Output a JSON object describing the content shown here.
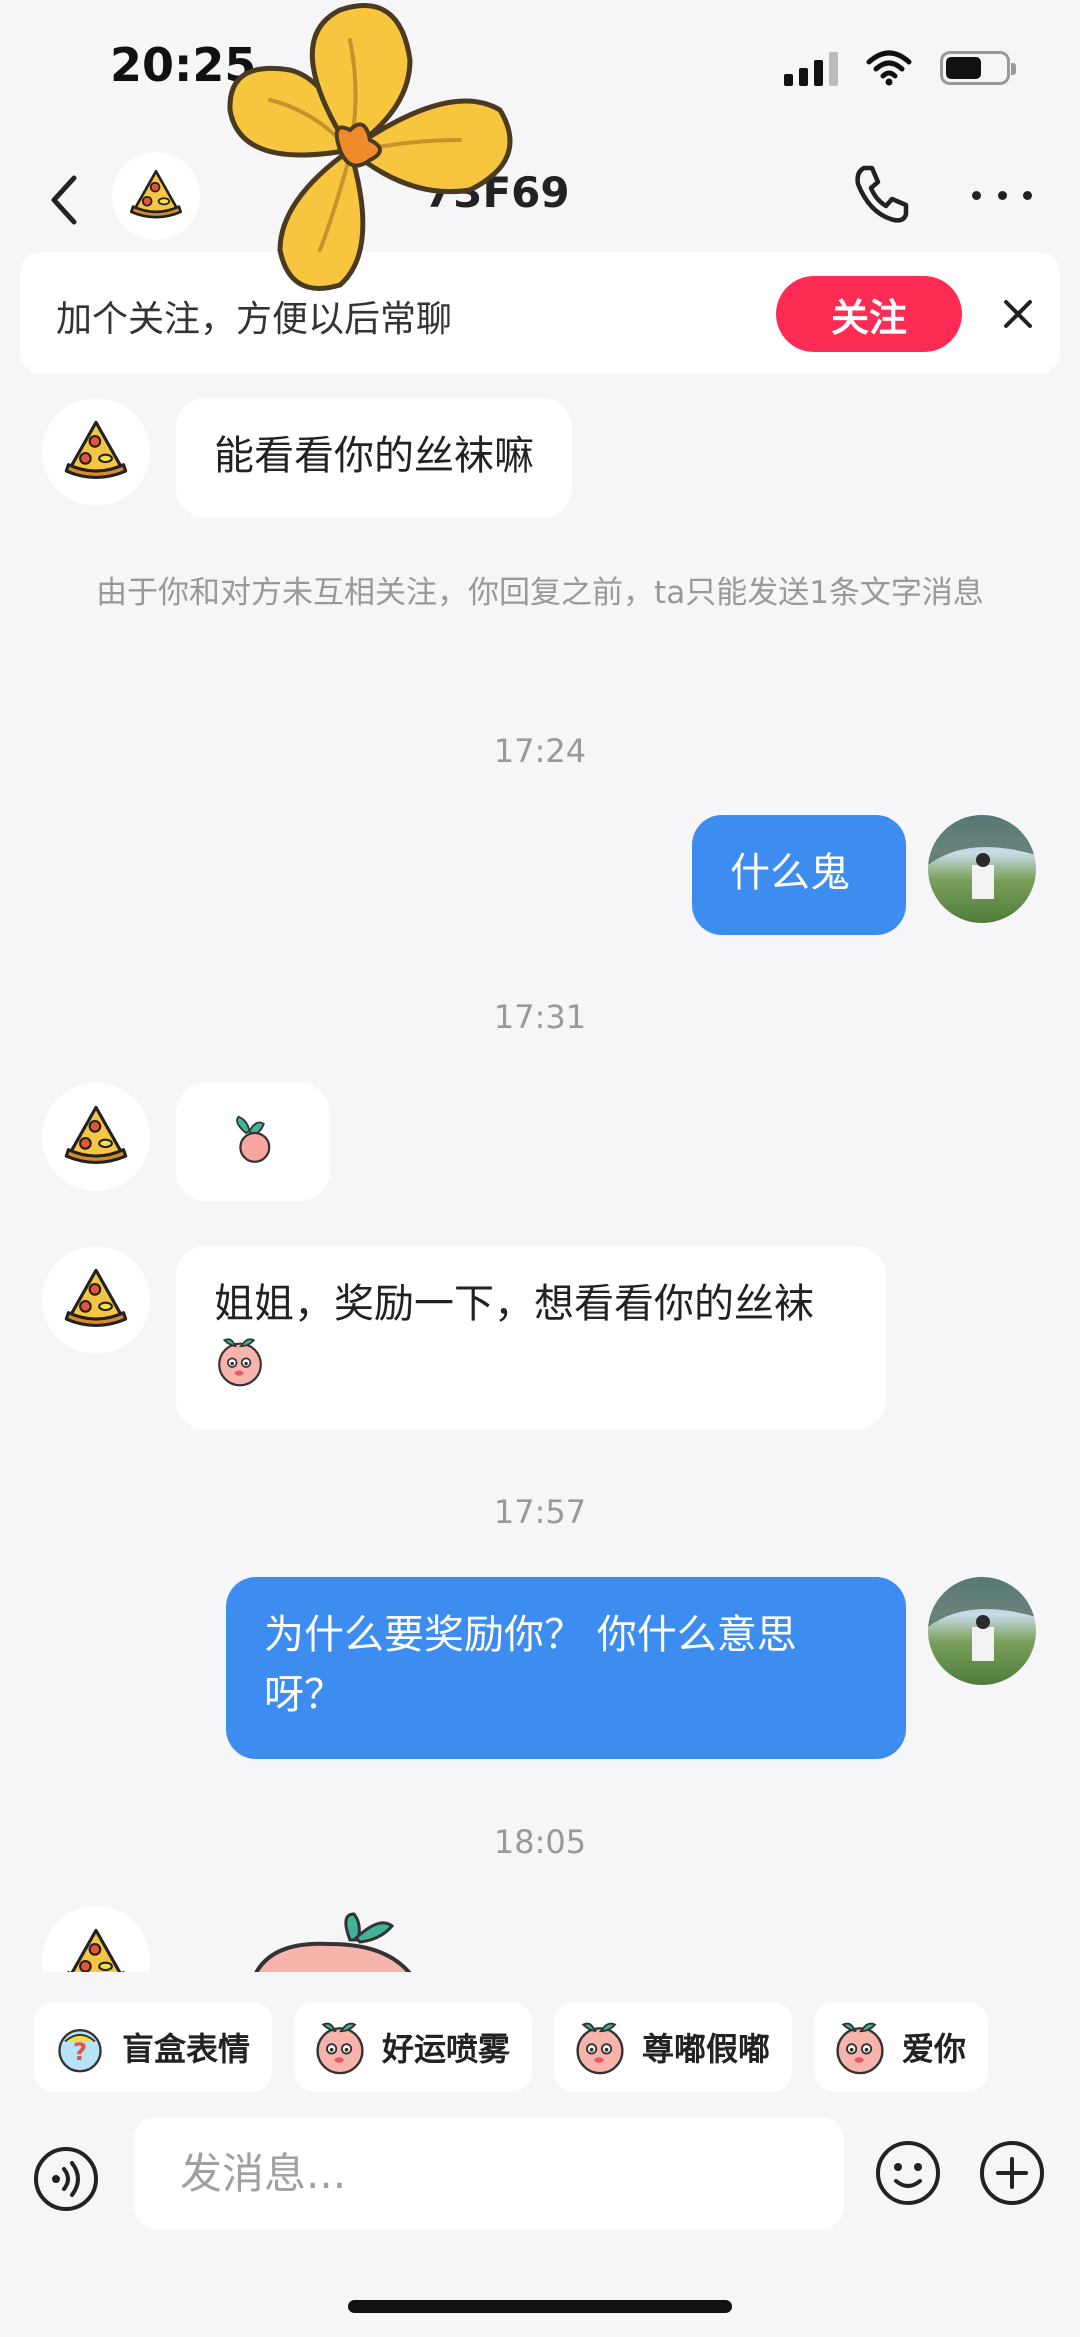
{
  "status_bar": {
    "time": "20:25"
  },
  "header": {
    "name": "73F69"
  },
  "follow_banner": {
    "text": "加个关注，方便以后常聊",
    "button": "关注"
  },
  "messages": {
    "m1": "能看看你的丝袜嘛",
    "system_note": "由于你和对方未互相关注，你回复之前，ta只能发送1条文字消息",
    "t1": "17:24",
    "m2": "什么鬼",
    "t2": "17:31",
    "m4": "姐姐，奖励一下，想看看你的丝袜",
    "t3": "17:57",
    "m5": "为什么要奖励你？ 你什么意思呀？",
    "t4": "18:05"
  },
  "quick_replies": [
    "盲盒表情",
    "好运喷雾",
    "尊嘟假嘟",
    "爱你"
  ],
  "input": {
    "placeholder": "发消息..."
  },
  "colors": {
    "accent_red": "#fe2c55",
    "bubble_blue": "#3d8df0",
    "background": "#f6f6f8"
  },
  "icons": [
    "back-arrow-icon",
    "pizza-avatar-icon",
    "phone-icon",
    "more-icon",
    "close-icon",
    "voice-icon",
    "emoji-icon",
    "plus-icon",
    "flower-sticker"
  ]
}
